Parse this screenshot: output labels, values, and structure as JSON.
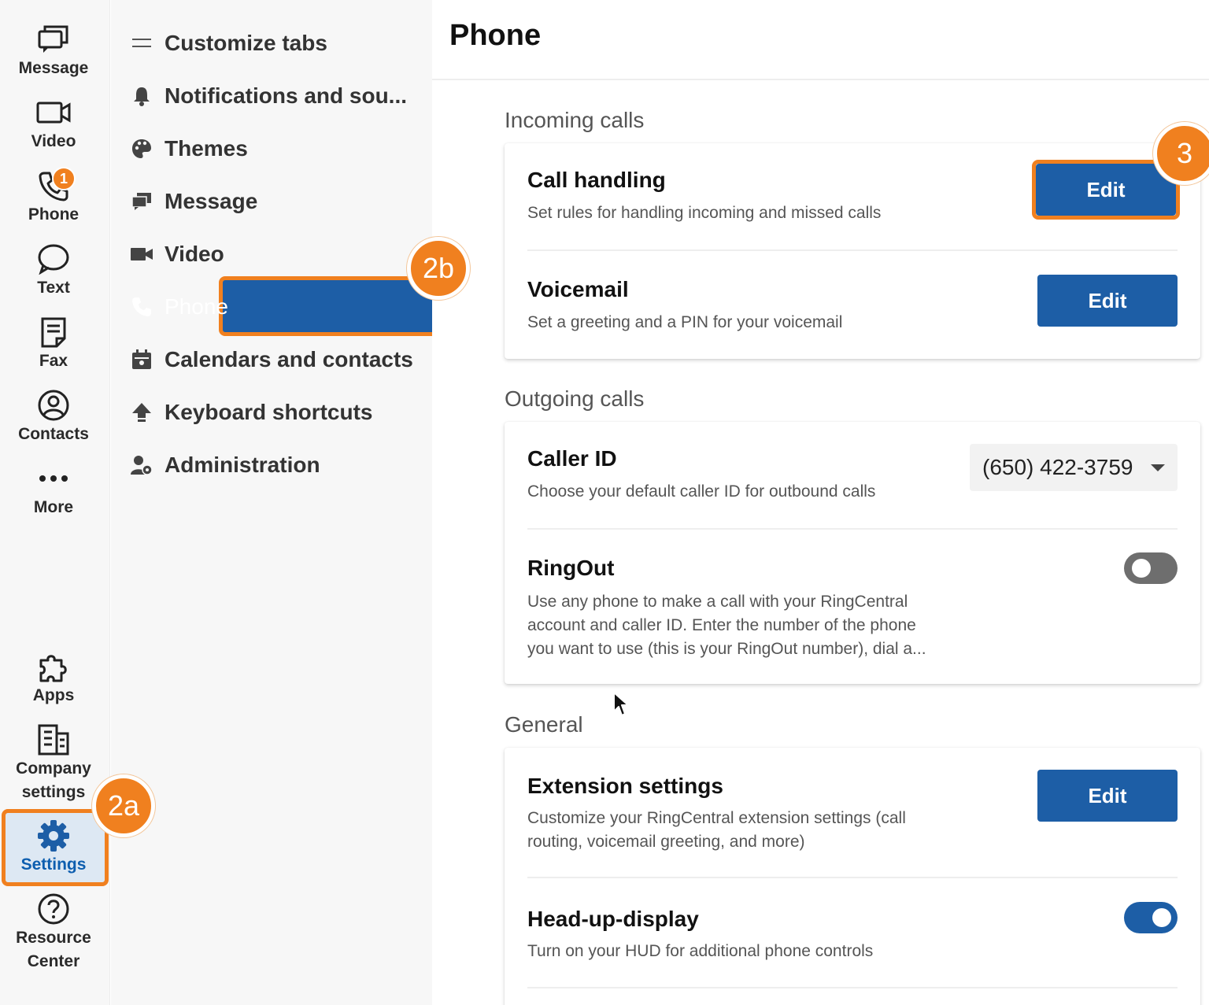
{
  "rail": {
    "items": [
      {
        "label": "Message",
        "icon": "message-icon"
      },
      {
        "label": "Video",
        "icon": "video-icon"
      },
      {
        "label": "Phone",
        "icon": "phone-icon",
        "badge": "1"
      },
      {
        "label": "Text",
        "icon": "chat-bubble-icon"
      },
      {
        "label": "Fax",
        "icon": "fax-icon"
      },
      {
        "label": "Contacts",
        "icon": "contacts-icon"
      },
      {
        "label": "More",
        "icon": "more-icon"
      },
      {
        "label": "Apps",
        "icon": "puzzle-icon"
      },
      {
        "label_line1": "Company",
        "label_line2": "settings",
        "icon": "building-icon"
      },
      {
        "label": "Settings",
        "icon": "gear-icon",
        "active": true
      },
      {
        "label_line1": "Resource",
        "label_line2": "Center",
        "icon": "help-icon"
      }
    ]
  },
  "nav": {
    "items": [
      {
        "label": "Customize tabs",
        "icon": "menu-icon"
      },
      {
        "label": "Notifications and sou...",
        "icon": "bell-icon"
      },
      {
        "label": "Themes",
        "icon": "palette-icon"
      },
      {
        "label": "Message",
        "icon": "message-icon"
      },
      {
        "label": "Video",
        "icon": "video-icon"
      },
      {
        "label": "Phone",
        "icon": "phone-icon",
        "active": true
      },
      {
        "label": "Calendars and contacts",
        "icon": "calendar-icon"
      },
      {
        "label": "Keyboard shortcuts",
        "icon": "shortcut-icon"
      },
      {
        "label": "Administration",
        "icon": "admin-icon"
      }
    ]
  },
  "callouts": {
    "c2a": "2a",
    "c2b": "2b",
    "c3": "3"
  },
  "main": {
    "title": "Phone",
    "incoming": {
      "heading": "Incoming calls",
      "call_handling": {
        "title": "Call handling",
        "desc": "Set rules for handling incoming and missed calls",
        "button": "Edit"
      },
      "voicemail": {
        "title": "Voicemail",
        "desc": "Set a greeting and a PIN for your voicemail",
        "button": "Edit"
      }
    },
    "outgoing": {
      "heading": "Outgoing calls",
      "caller_id": {
        "title": "Caller ID",
        "desc": "Choose your default caller ID for outbound calls",
        "value": "(650) 422-3759"
      },
      "ringout": {
        "title": "RingOut",
        "desc_line1": "Use any phone to make a call with your RingCentral",
        "desc_line2": "account and caller ID. Enter the number of the phone",
        "desc_line3": "you want to use (this is your RingOut number), dial a...",
        "enabled": false
      }
    },
    "general": {
      "heading": "General",
      "extension": {
        "title": "Extension settings",
        "desc_line1": "Customize your RingCentral extension settings (call",
        "desc_line2": "routing, voicemail greeting, and more)",
        "button": "Edit"
      },
      "hud": {
        "title": "Head-up-display",
        "desc": "Turn on your HUD for additional phone controls",
        "enabled": true
      }
    }
  },
  "colors": {
    "accent": "#1d5ea6",
    "callout": "#f0801f",
    "active_label": "#0d5eaf"
  }
}
